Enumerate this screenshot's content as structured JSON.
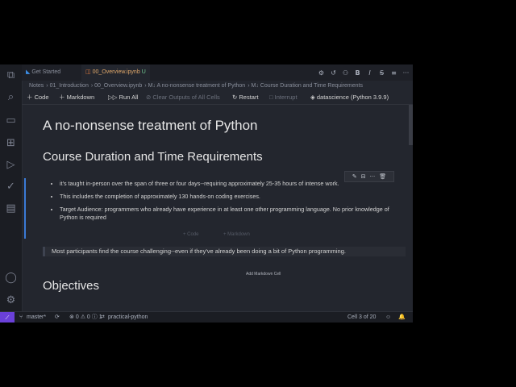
{
  "tabs": [
    {
      "label": "Get Started",
      "active": false
    },
    {
      "label": "00_Overview.ipynb",
      "badge": "U",
      "active": true
    }
  ],
  "breadcrumb": [
    "Notes",
    "01_Introduction",
    "00_Overview.ipynb",
    "M↓ A no-nonsense treatment of Python",
    "M↓ Course Duration and Time Requirements"
  ],
  "toolbar": {
    "code": "Code",
    "markdown": "Markdown",
    "run_all": "Run All",
    "clear_outputs": "Clear Outputs of All Cells",
    "restart": "Restart",
    "interrupt": "Interrupt",
    "kernel": "datascience (Python 3.9.9)"
  },
  "notebook": {
    "title": "A no-nonsense treatment of Python",
    "section": "Course Duration and Time Requirements",
    "bullets": [
      "it's taught in-person over the span of three or four days--requiring approximately 25-35 hours of intense work.",
      "This includes the completion of approximately 130 hands-on coding exercises.",
      "Target Audience: programmers who already have experience in at least one other programming language. No prior knowledge of Python is required"
    ],
    "ghost_code": "+ Code",
    "ghost_markdown": "+ Markdown",
    "quote": "Most participants find the course challenging--even if they've already been doing a bit of Python programming.",
    "add_markdown": "Add Markdown Cell",
    "objectives": "Objectives"
  },
  "status": {
    "branch": "master*",
    "errors": "0",
    "warnings": "0",
    "info": "1",
    "folder": "practical-python",
    "cell": "Cell 3 of 20"
  },
  "colors": {
    "accent": "#3b7bd6",
    "remote": "#6a40d9",
    "tab_active": "#e0a86b"
  }
}
